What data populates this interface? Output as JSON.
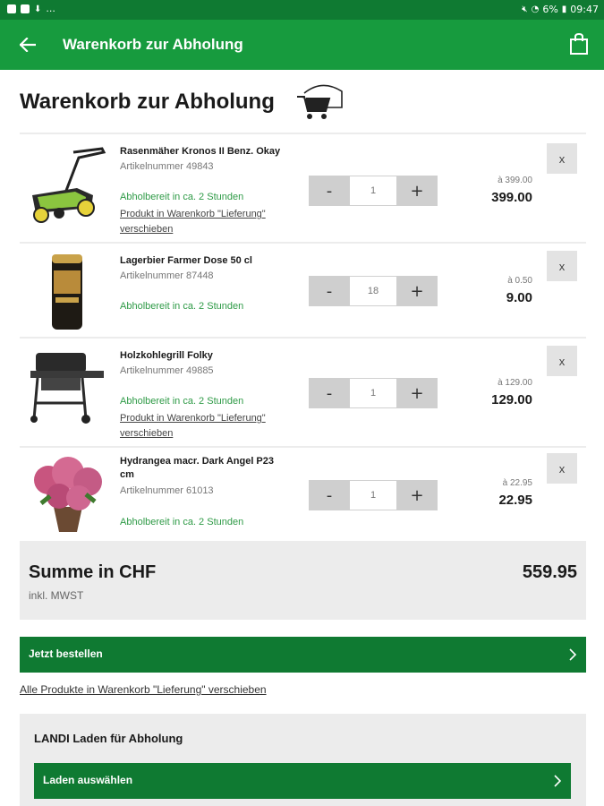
{
  "status_bar": {
    "left_more": "...",
    "battery_percent": "6%",
    "time": "09:47"
  },
  "app_bar": {
    "title": "Warenkorb zur Abholung",
    "back_icon": "arrow-left-icon",
    "cart_icon": "shopping-bag-icon"
  },
  "page": {
    "heading": "Warenkorb zur Abholung",
    "illustration": "cart-pickup-icon"
  },
  "items": [
    {
      "name": "Rasenmäher Kronos II Benz. Okay",
      "article": "Artikelnummer 49843",
      "availability": "Abholbereit in ca. 2 Stunden",
      "move_link": "Produkt in Warenkorb \"Lieferung\" verschieben",
      "quantity": "1",
      "unit_price": "à 399.00",
      "total": "399.00",
      "remove": "x",
      "minus": "-",
      "plus": "+"
    },
    {
      "name": "Lagerbier Farmer Dose 50 cl",
      "article": "Artikelnummer 87448",
      "availability": "Abholbereit in ca. 2 Stunden",
      "quantity": "18",
      "unit_price": "à 0.50",
      "total": "9.00",
      "remove": "x",
      "minus": "-",
      "plus": "+"
    },
    {
      "name": "Holzkohlegrill Folky",
      "article": "Artikelnummer 49885",
      "availability": "Abholbereit in ca. 2 Stunden",
      "move_link": "Produkt in Warenkorb \"Lieferung\" verschieben",
      "quantity": "1",
      "unit_price": "à 129.00",
      "total": "129.00",
      "remove": "x",
      "minus": "-",
      "plus": "+"
    },
    {
      "name": "Hydrangea macr. Dark Angel P23 cm",
      "article": "Artikelnummer 61013",
      "availability": "Abholbereit in ca. 2 Stunden",
      "quantity": "1",
      "unit_price": "à 22.95",
      "total": "22.95",
      "remove": "x",
      "minus": "-",
      "plus": "+"
    }
  ],
  "summary": {
    "label": "Summe in CHF",
    "vat_note": "inkl. MWST",
    "total": "559.95"
  },
  "actions": {
    "order_label": "Jetzt bestellen",
    "move_all_label": "Alle Produkte in Warenkorb \"Lieferung\" verschieben"
  },
  "store": {
    "title": "LANDI Laden für Abholung",
    "select_label": "Laden auswählen"
  },
  "colors": {
    "status_bar": "#0f7a32",
    "app_bar": "#179b3e",
    "primary_button": "#0f7a32",
    "availability_text": "#2e9a46"
  }
}
